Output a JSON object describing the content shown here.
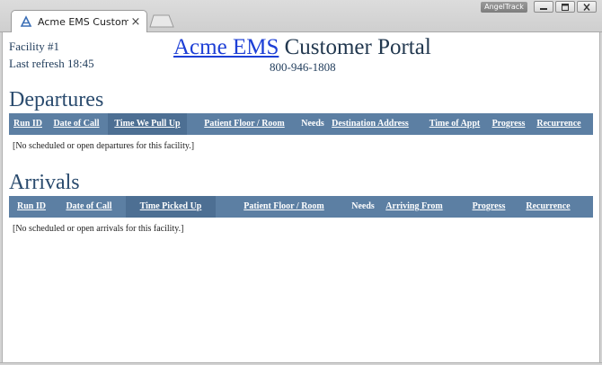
{
  "browser": {
    "tab_title": "Acme EMS Customer Portal",
    "tab_close": "×",
    "brand_badge": "AngelTrack"
  },
  "header": {
    "facility": "Facility #1",
    "last_refresh": "Last refresh 18:45",
    "title_link": "Acme EMS",
    "title_rest": " Customer Portal",
    "phone": "800-946-1808"
  },
  "departures": {
    "title": "Departures",
    "columns": {
      "run_id": "Run ID",
      "date_of_call": "Date of Call",
      "time_pull_up": "Time We Pull Up",
      "patient_floor_room": "Patient Floor / Room",
      "needs": "Needs",
      "destination": "Destination Address",
      "time_of_appt": "Time of Appt",
      "progress": "Progress",
      "recurrence": "Recurrence"
    },
    "empty_message": "[No scheduled or open departures for this facility.]"
  },
  "arrivals": {
    "title": "Arrivals",
    "columns": {
      "run_id": "Run ID",
      "date_of_call": "Date of Call",
      "time_picked_up": "Time Picked Up",
      "patient_floor_room": "Patient Floor / Room",
      "needs": "Needs",
      "arriving_from": "Arriving From",
      "progress": "Progress",
      "recurrence": "Recurrence"
    },
    "empty_message": "[No scheduled or open arrivals for this facility.]"
  },
  "colors": {
    "header_bar": "#5c7fa3",
    "sorted_column": "#4d6f93",
    "title_link": "#1d3fd6"
  }
}
